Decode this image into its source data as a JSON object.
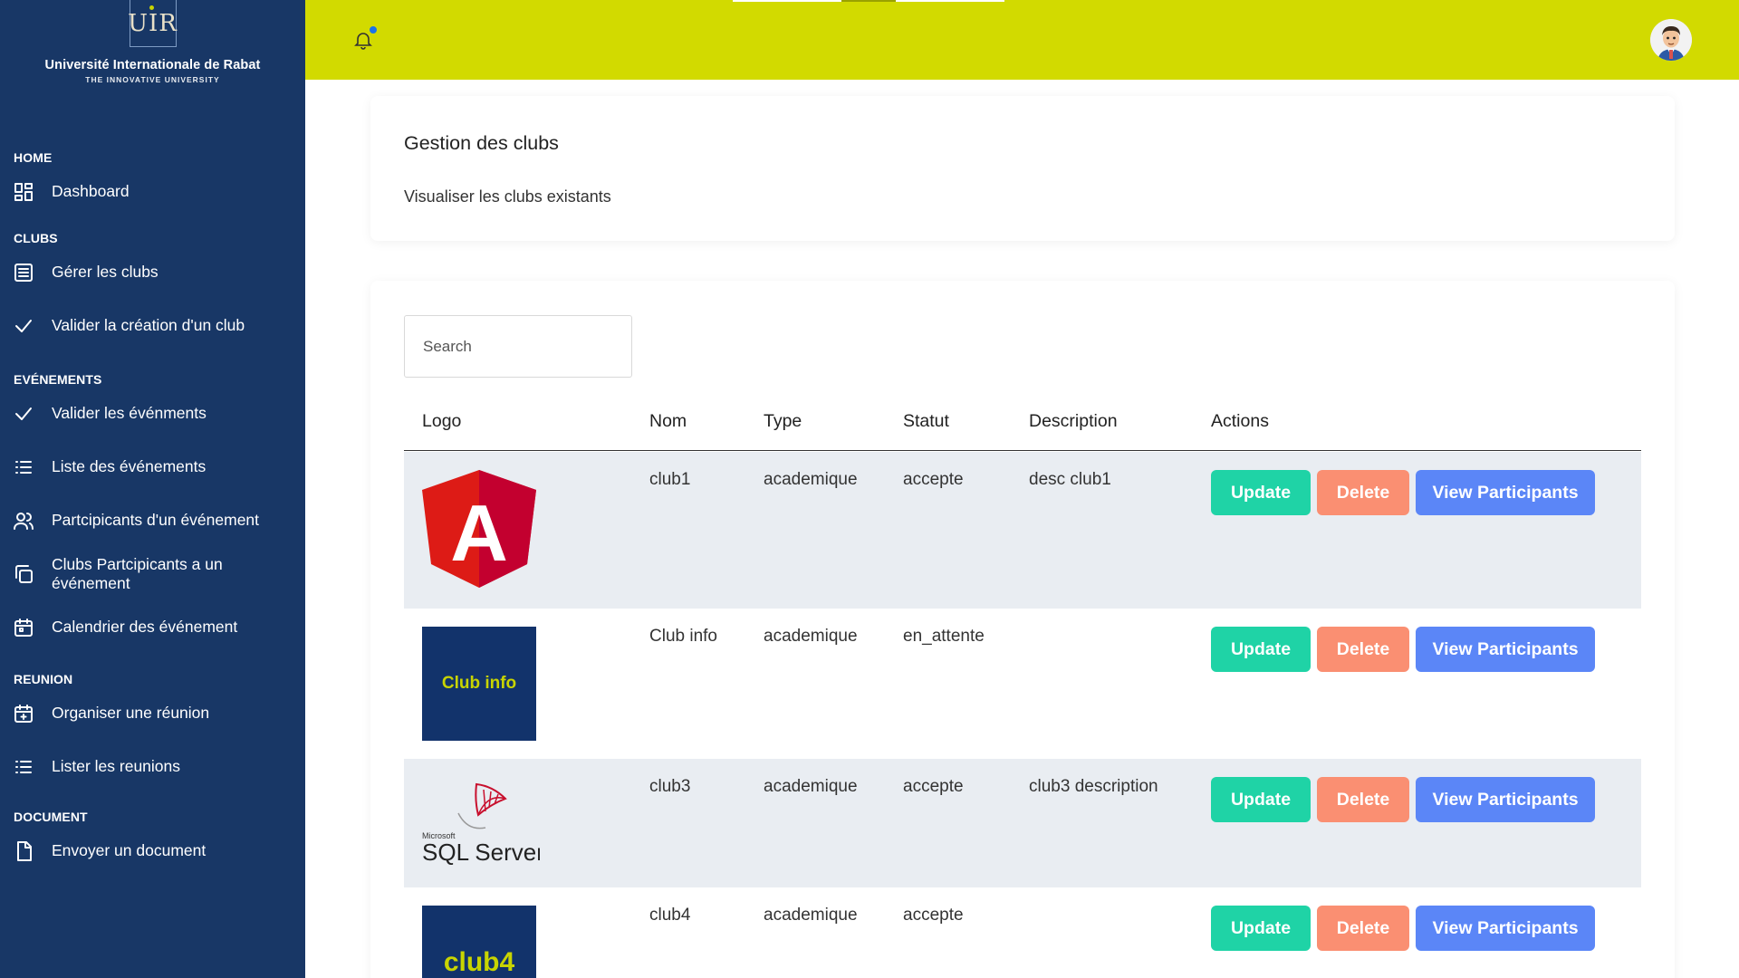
{
  "brand": {
    "logo_text": "UIR",
    "name": "Université Internationale de Rabat",
    "tagline": "THE INNOVATIVE UNIVERSITY"
  },
  "sidebar": {
    "sections": [
      {
        "title": "HOME",
        "items": [
          {
            "label": "Dashboard",
            "icon": "dashboard-icon"
          }
        ]
      },
      {
        "title": "CLUBS",
        "items": [
          {
            "label": "Gérer les clubs",
            "icon": "list-box-icon"
          },
          {
            "label": "Valider la création d'un club",
            "icon": "check-icon"
          }
        ]
      },
      {
        "title": "EVÉNEMENTS",
        "items": [
          {
            "label": "Valider les événments",
            "icon": "check-icon"
          },
          {
            "label": "Liste des événements",
            "icon": "list-icon"
          },
          {
            "label": "Partcipicants d'un événement",
            "icon": "users-icon"
          },
          {
            "label": "Clubs Partcipicants a un événement",
            "icon": "copy-icon"
          },
          {
            "label": "Calendrier des événement",
            "icon": "calendar-icon"
          }
        ]
      },
      {
        "title": "REUNION",
        "items": [
          {
            "label": "Organiser une réunion",
            "icon": "calendar-plus-icon"
          },
          {
            "label": "Lister les reunions",
            "icon": "list-icon"
          }
        ]
      },
      {
        "title": "DOCUMENT",
        "items": [
          {
            "label": "Envoyer un document",
            "icon": "document-icon"
          }
        ]
      }
    ]
  },
  "header": {
    "notification_icon": "bell-icon",
    "has_unread": true,
    "avatar_icon": "user-avatar"
  },
  "page": {
    "title": "Gestion des clubs",
    "subtitle": "Visualiser les clubs existants"
  },
  "search": {
    "placeholder": "Search",
    "value": ""
  },
  "table": {
    "columns": [
      "Logo",
      "Nom",
      "Type",
      "Statut",
      "Description",
      "Actions"
    ],
    "rows": [
      {
        "logo": "angular-logo",
        "logo_text": "A",
        "nom": "club1",
        "type": "academique",
        "statut": "accepte",
        "description": "desc club1"
      },
      {
        "logo": "text-logo",
        "logo_text": "Club info",
        "nom": "Club info",
        "type": "academique",
        "statut": "en_attente",
        "description": ""
      },
      {
        "logo": "sqlserver-logo",
        "logo_text": "SQL Server",
        "logo_small": "Microsoft",
        "nom": "club3",
        "type": "academique",
        "statut": "accepte",
        "description": "club3 description"
      },
      {
        "logo": "text-logo",
        "logo_text": "club4",
        "nom": "club4",
        "type": "academique",
        "statut": "accepte",
        "description": ""
      }
    ],
    "actions": {
      "update": "Update",
      "delete": "Delete",
      "view": "View Participants"
    }
  },
  "colors": {
    "sidebar_bg": "#183766",
    "topbar_bg": "#d2da00",
    "update": "#1fd3a6",
    "delete": "#fa8f72",
    "view": "#5b86f7",
    "row_alt": "#e9edf2",
    "logo_box_bg": "#12336b",
    "logo_box_text": "#c8d400"
  }
}
